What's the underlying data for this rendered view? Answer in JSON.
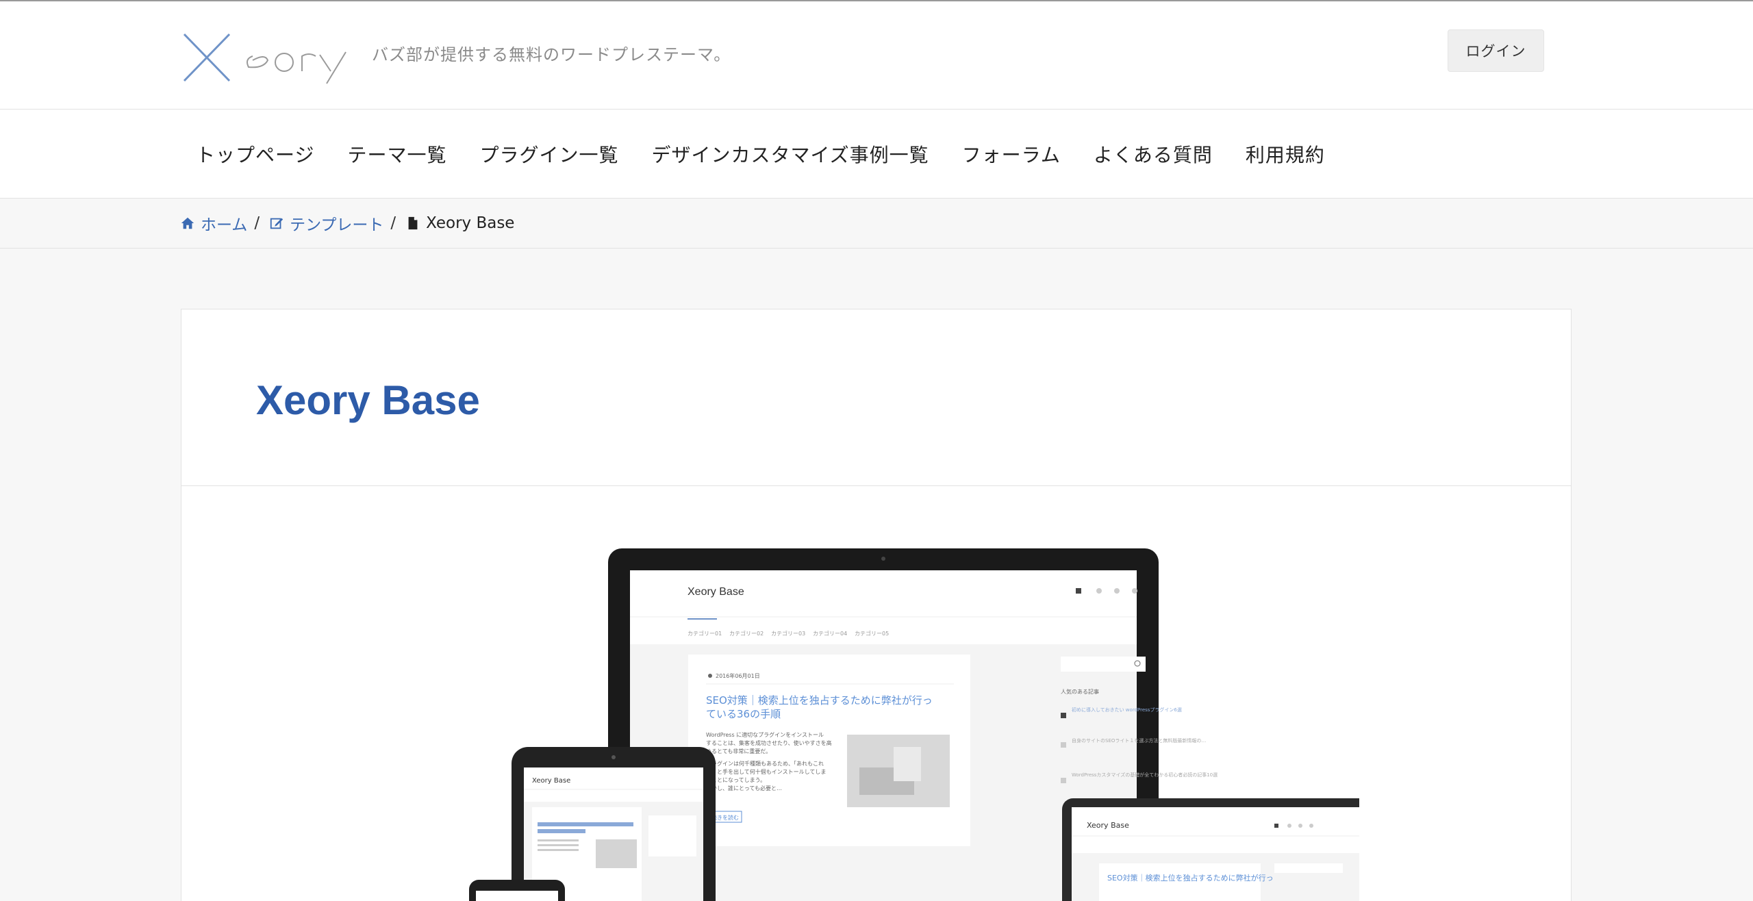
{
  "header": {
    "logo_text": "Xeory",
    "tagline": "バズ部が提供する無料のワードプレステーマ。",
    "login_label": "ログイン"
  },
  "nav": {
    "items": [
      {
        "label": "トップページ"
      },
      {
        "label": "テーマ一覧"
      },
      {
        "label": "プラグイン一覧"
      },
      {
        "label": "デザインカスタマイズ事例一覧"
      },
      {
        "label": "フォーラム"
      },
      {
        "label": "よくある質問"
      },
      {
        "label": "利用規約"
      }
    ]
  },
  "breadcrumb": {
    "home": "ホーム",
    "category": "テンプレート",
    "current": "Xeory Base",
    "separator": "/"
  },
  "post": {
    "title": "Xeory Base"
  },
  "mockup": {
    "site_title": "Xeory Base",
    "nav": [
      "カテゴリー01",
      "カテゴリー02",
      "カテゴリー03",
      "カテゴリー04",
      "カテゴリー05"
    ],
    "date": "2016年06月01日",
    "article_title_line1": "SEO対策｜検索上位を独占するために弊社が行っ",
    "article_title_line2": "ている36の手順",
    "excerpt_lines": [
      "WordPress に適切なプラグインをインストール",
      "することは、集客を成功させたり、使いやすさを高",
      "めるとても非常に重要だ。",
      "プラグインは何千種類もあるため、「あれもこれ",
      "も」と手を出して何十個もインストールしてしま",
      "うことになってしまう。",
      "しかし、誰にとっても必要と…"
    ],
    "read_more": "続きを読む",
    "sidebar_heading": "人気のある記事",
    "sidebar_items": [
      "初めに導入しておきたい wordPressプラグイン6選",
      "自身のサイトのSEOライト１を選ぶ方法と無料版最新情報の…",
      "WordPressカスタマイズの基礎が全てわかる初心者必読の記事10選"
    ],
    "small_site_title": "Xeory Base",
    "small_article_title": "SEO対策｜検索上位を独占するために弊社が行っ"
  },
  "colors": {
    "accent": "#2d5ba8",
    "link": "#3b6ab3",
    "logo_x": "#6f93c8"
  }
}
